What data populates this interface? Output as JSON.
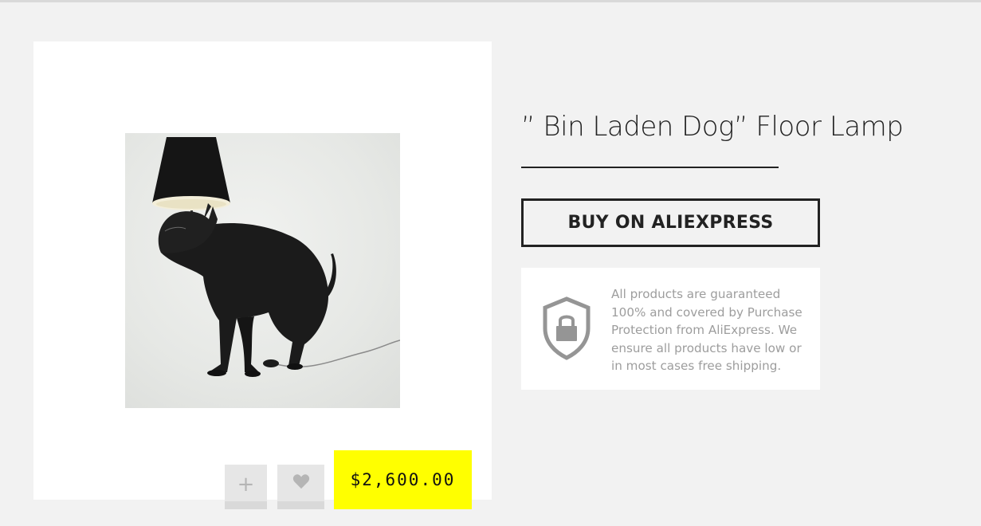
{
  "product": {
    "title": "” Bin Laden Dog” Floor Lamp",
    "price": "$2,600.00",
    "image": "dog-lamp-photo"
  },
  "actions": {
    "add_label": "+",
    "favorite_icon": "heart-icon",
    "buy_label": "BUY ON ALIEXPRESS"
  },
  "guarantee": {
    "icon": "shield-lock-icon",
    "text": "All products are guaranteed 100% and covered by Purchase Protection from AliExpress. We ensure all products have low or in most cases free shipping."
  },
  "colors": {
    "price_background": "#ffff00",
    "page_background": "#f2f2f2"
  }
}
